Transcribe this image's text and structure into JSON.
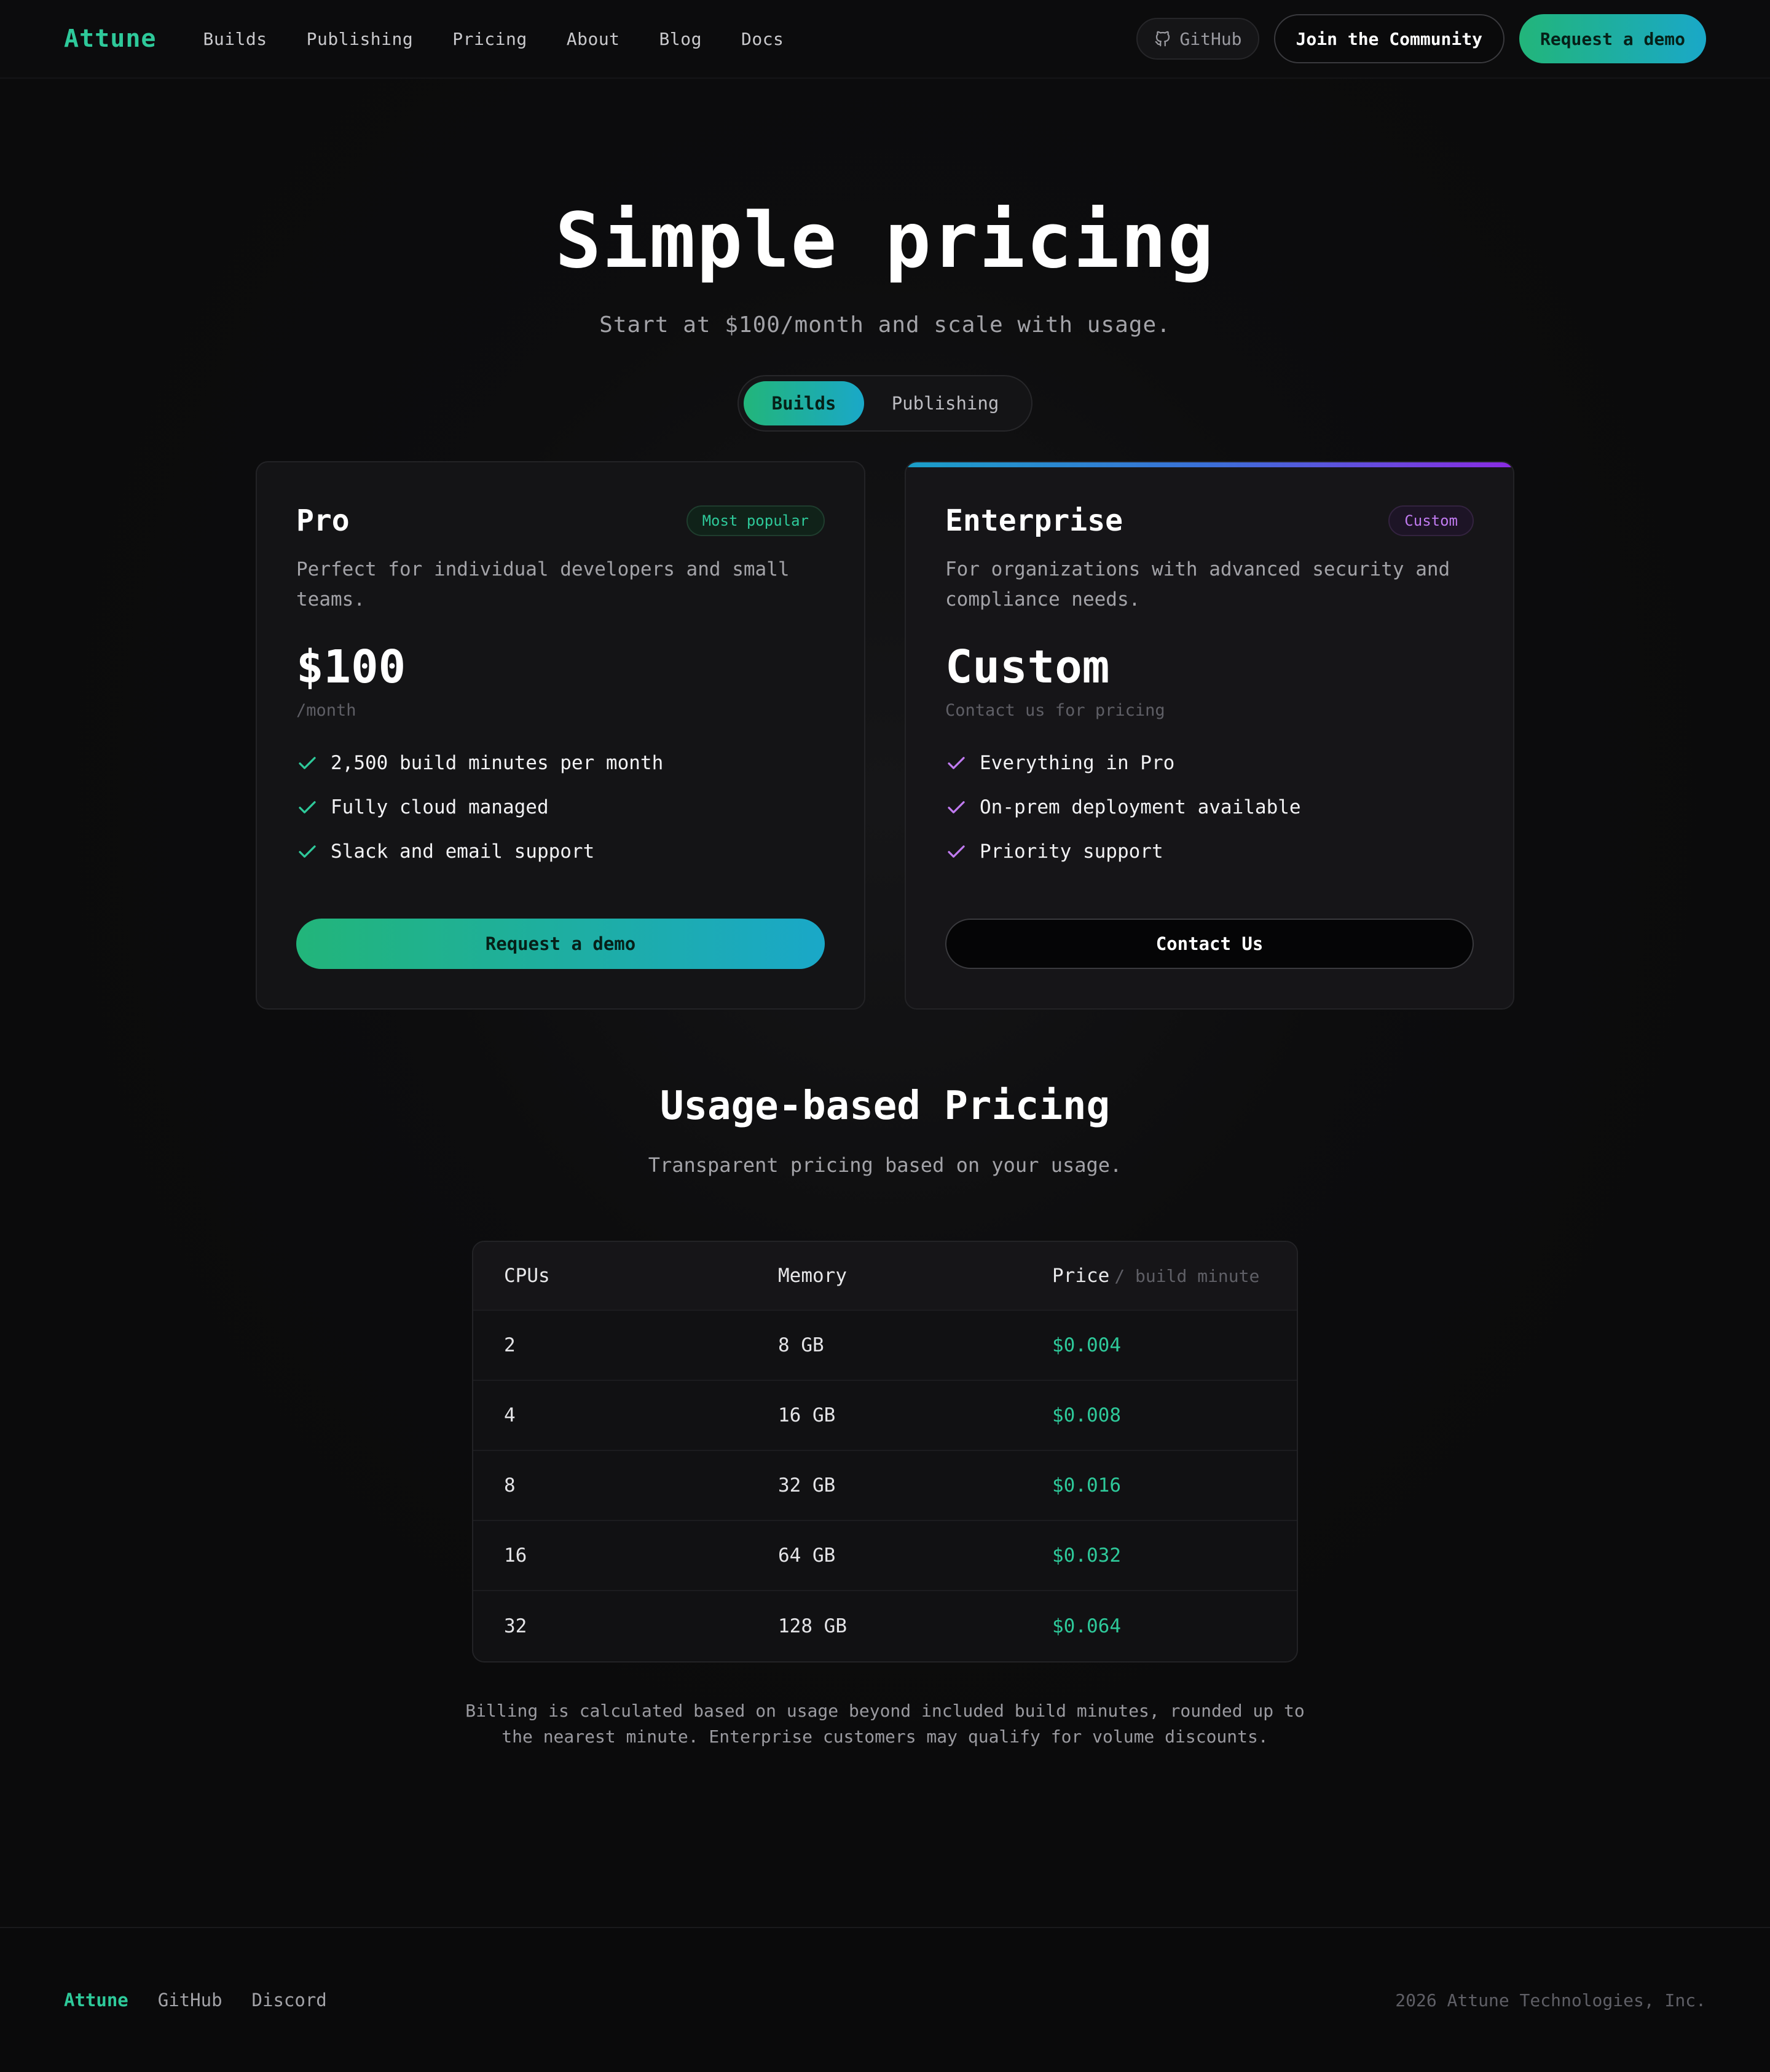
{
  "nav": {
    "brand": "Attune",
    "links": [
      "Builds",
      "Publishing",
      "Pricing",
      "About",
      "Blog",
      "Docs"
    ],
    "github_label": "GitHub",
    "community_label": "Join the Community",
    "demo_label": "Request a demo"
  },
  "hero": {
    "title": "Simple pricing",
    "subtitle": "Start at $100/month and scale with usage.",
    "toggle": {
      "selected": "Builds",
      "options": [
        "Builds",
        "Publishing"
      ]
    }
  },
  "plans": [
    {
      "name": "Pro",
      "badge": "Most popular",
      "description": "Perfect for individual developers and small teams.",
      "price": "$100",
      "price_unit": "/month",
      "features": [
        "2,500 build minutes per month",
        "Fully cloud managed",
        "Slack and email support"
      ],
      "cta": "Request a demo",
      "accent": "#2ec99a"
    },
    {
      "name": "Enterprise",
      "badge": "Custom",
      "description": "For organizations with advanced security and compliance needs.",
      "price": "Custom",
      "price_unit": "Contact us for pricing",
      "features": [
        "Everything in Pro",
        "On-prem deployment available",
        "Priority support"
      ],
      "cta": "Contact Us",
      "accent": "#c07af0"
    }
  ],
  "usage": {
    "title": "Usage-based Pricing",
    "subtitle": "Transparent pricing based on your usage.",
    "columns": {
      "cpus": "CPUs",
      "memory": "Memory",
      "price": "Price",
      "price_unit": "/ build minute"
    },
    "rows": [
      {
        "cpus": "2",
        "memory": "8 GB",
        "price": "$0.004"
      },
      {
        "cpus": "4",
        "memory": "16 GB",
        "price": "$0.008"
      },
      {
        "cpus": "8",
        "memory": "32 GB",
        "price": "$0.016"
      },
      {
        "cpus": "16",
        "memory": "64 GB",
        "price": "$0.032"
      },
      {
        "cpus": "32",
        "memory": "128 GB",
        "price": "$0.064"
      }
    ],
    "note": "Billing is calculated based on usage beyond included build minutes, rounded up to the nearest minute. Enterprise customers may qualify for volume discounts."
  },
  "footer": {
    "brand": "Attune",
    "links": [
      "GitHub",
      "Discord"
    ],
    "copyright": "2026 Attune Technologies, Inc."
  },
  "colors": {
    "brand_green": "#2ec99a",
    "accent_purple": "#c07af0",
    "background": "#0b0b0c"
  }
}
